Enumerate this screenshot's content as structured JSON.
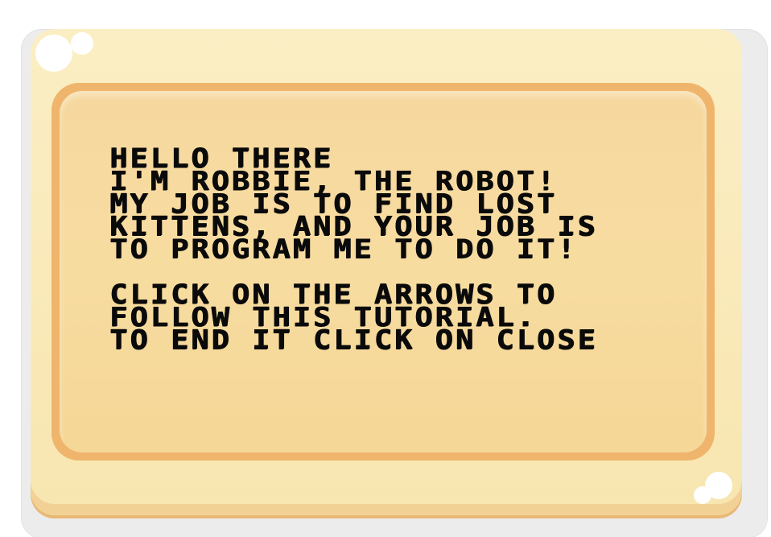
{
  "dialog": {
    "paragraph1": [
      "Hello There",
      "I'm Robbie, the Robot!",
      "My job is to find lost",
      "kittens, and your job is",
      "to program me to do it!"
    ],
    "paragraph2": [
      "Click on the arrows to",
      "follow this tutorial.",
      "To end it click on close"
    ]
  },
  "colors": {
    "panel": "#f8e6b0",
    "rim": "#efb56c",
    "inner": "#f6d89e",
    "text": "#0a0a0a"
  }
}
